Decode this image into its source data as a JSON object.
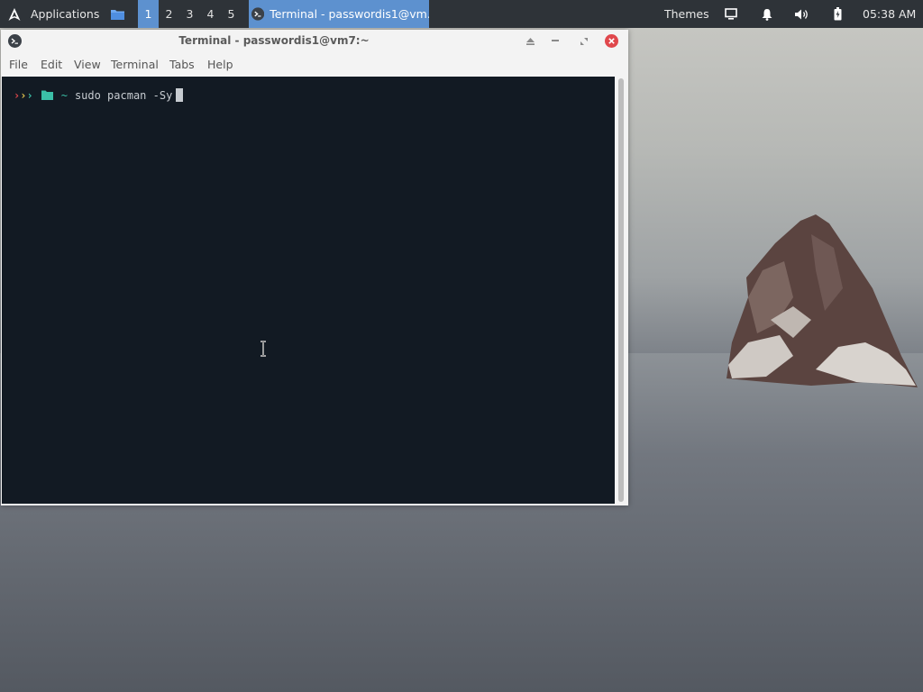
{
  "panel": {
    "applications_label": "Applications",
    "workspaces": [
      "1",
      "2",
      "3",
      "4",
      "5"
    ],
    "active_workspace": "1",
    "task_label": "Terminal - passwordis1@vm...",
    "themes_label": "Themes",
    "clock": "05:38 AM"
  },
  "window": {
    "title": "Terminal - passwordis1@vm7:~",
    "menus": [
      "File",
      "Edit",
      "View",
      "Terminal",
      "Tabs",
      "Help"
    ]
  },
  "terminal": {
    "prompt_arrows": ">>>",
    "cwd": "~",
    "command": "sudo pacman -Sy",
    "background": "#121a23"
  },
  "colors": {
    "panel_bg": "#2e3338",
    "accent": "#5d91cf",
    "close_red": "#e0474c",
    "folder_teal": "#3bbfa7",
    "arrow_colors": [
      "#e0474c",
      "#e5c64f",
      "#3bbfa7"
    ]
  },
  "icons": {
    "apps": "arch-logo-icon",
    "files": "folder-icon",
    "task": "terminal-icon",
    "display": "display-icon",
    "notifications": "bell-icon",
    "volume": "volume-icon",
    "battery": "battery-icon"
  }
}
